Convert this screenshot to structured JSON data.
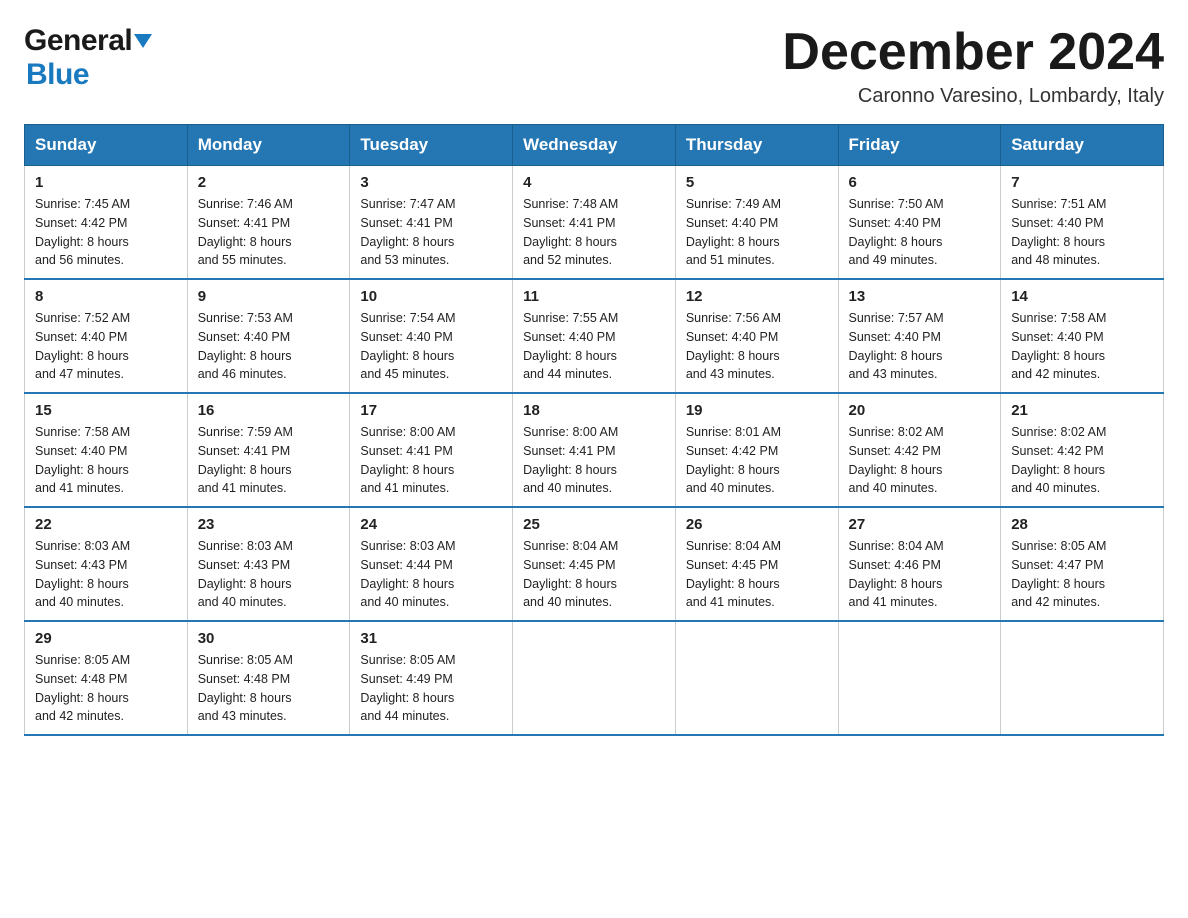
{
  "header": {
    "logo_general": "General",
    "logo_blue": "Blue",
    "title": "December 2024",
    "location": "Caronno Varesino, Lombardy, Italy"
  },
  "calendar": {
    "days_of_week": [
      "Sunday",
      "Monday",
      "Tuesday",
      "Wednesday",
      "Thursday",
      "Friday",
      "Saturday"
    ],
    "weeks": [
      [
        {
          "day": "1",
          "sunrise": "7:45 AM",
          "sunset": "4:42 PM",
          "daylight": "8 hours and 56 minutes."
        },
        {
          "day": "2",
          "sunrise": "7:46 AM",
          "sunset": "4:41 PM",
          "daylight": "8 hours and 55 minutes."
        },
        {
          "day": "3",
          "sunrise": "7:47 AM",
          "sunset": "4:41 PM",
          "daylight": "8 hours and 53 minutes."
        },
        {
          "day": "4",
          "sunrise": "7:48 AM",
          "sunset": "4:41 PM",
          "daylight": "8 hours and 52 minutes."
        },
        {
          "day": "5",
          "sunrise": "7:49 AM",
          "sunset": "4:40 PM",
          "daylight": "8 hours and 51 minutes."
        },
        {
          "day": "6",
          "sunrise": "7:50 AM",
          "sunset": "4:40 PM",
          "daylight": "8 hours and 49 minutes."
        },
        {
          "day": "7",
          "sunrise": "7:51 AM",
          "sunset": "4:40 PM",
          "daylight": "8 hours and 48 minutes."
        }
      ],
      [
        {
          "day": "8",
          "sunrise": "7:52 AM",
          "sunset": "4:40 PM",
          "daylight": "8 hours and 47 minutes."
        },
        {
          "day": "9",
          "sunrise": "7:53 AM",
          "sunset": "4:40 PM",
          "daylight": "8 hours and 46 minutes."
        },
        {
          "day": "10",
          "sunrise": "7:54 AM",
          "sunset": "4:40 PM",
          "daylight": "8 hours and 45 minutes."
        },
        {
          "day": "11",
          "sunrise": "7:55 AM",
          "sunset": "4:40 PM",
          "daylight": "8 hours and 44 minutes."
        },
        {
          "day": "12",
          "sunrise": "7:56 AM",
          "sunset": "4:40 PM",
          "daylight": "8 hours and 43 minutes."
        },
        {
          "day": "13",
          "sunrise": "7:57 AM",
          "sunset": "4:40 PM",
          "daylight": "8 hours and 43 minutes."
        },
        {
          "day": "14",
          "sunrise": "7:58 AM",
          "sunset": "4:40 PM",
          "daylight": "8 hours and 42 minutes."
        }
      ],
      [
        {
          "day": "15",
          "sunrise": "7:58 AM",
          "sunset": "4:40 PM",
          "daylight": "8 hours and 41 minutes."
        },
        {
          "day": "16",
          "sunrise": "7:59 AM",
          "sunset": "4:41 PM",
          "daylight": "8 hours and 41 minutes."
        },
        {
          "day": "17",
          "sunrise": "8:00 AM",
          "sunset": "4:41 PM",
          "daylight": "8 hours and 41 minutes."
        },
        {
          "day": "18",
          "sunrise": "8:00 AM",
          "sunset": "4:41 PM",
          "daylight": "8 hours and 40 minutes."
        },
        {
          "day": "19",
          "sunrise": "8:01 AM",
          "sunset": "4:42 PM",
          "daylight": "8 hours and 40 minutes."
        },
        {
          "day": "20",
          "sunrise": "8:02 AM",
          "sunset": "4:42 PM",
          "daylight": "8 hours and 40 minutes."
        },
        {
          "day": "21",
          "sunrise": "8:02 AM",
          "sunset": "4:42 PM",
          "daylight": "8 hours and 40 minutes."
        }
      ],
      [
        {
          "day": "22",
          "sunrise": "8:03 AM",
          "sunset": "4:43 PM",
          "daylight": "8 hours and 40 minutes."
        },
        {
          "day": "23",
          "sunrise": "8:03 AM",
          "sunset": "4:43 PM",
          "daylight": "8 hours and 40 minutes."
        },
        {
          "day": "24",
          "sunrise": "8:03 AM",
          "sunset": "4:44 PM",
          "daylight": "8 hours and 40 minutes."
        },
        {
          "day": "25",
          "sunrise": "8:04 AM",
          "sunset": "4:45 PM",
          "daylight": "8 hours and 40 minutes."
        },
        {
          "day": "26",
          "sunrise": "8:04 AM",
          "sunset": "4:45 PM",
          "daylight": "8 hours and 41 minutes."
        },
        {
          "day": "27",
          "sunrise": "8:04 AM",
          "sunset": "4:46 PM",
          "daylight": "8 hours and 41 minutes."
        },
        {
          "day": "28",
          "sunrise": "8:05 AM",
          "sunset": "4:47 PM",
          "daylight": "8 hours and 42 minutes."
        }
      ],
      [
        {
          "day": "29",
          "sunrise": "8:05 AM",
          "sunset": "4:48 PM",
          "daylight": "8 hours and 42 minutes."
        },
        {
          "day": "30",
          "sunrise": "8:05 AM",
          "sunset": "4:48 PM",
          "daylight": "8 hours and 43 minutes."
        },
        {
          "day": "31",
          "sunrise": "8:05 AM",
          "sunset": "4:49 PM",
          "daylight": "8 hours and 44 minutes."
        },
        null,
        null,
        null,
        null
      ]
    ]
  },
  "labels": {
    "sunrise": "Sunrise:",
    "sunset": "Sunset:",
    "daylight": "Daylight:"
  }
}
